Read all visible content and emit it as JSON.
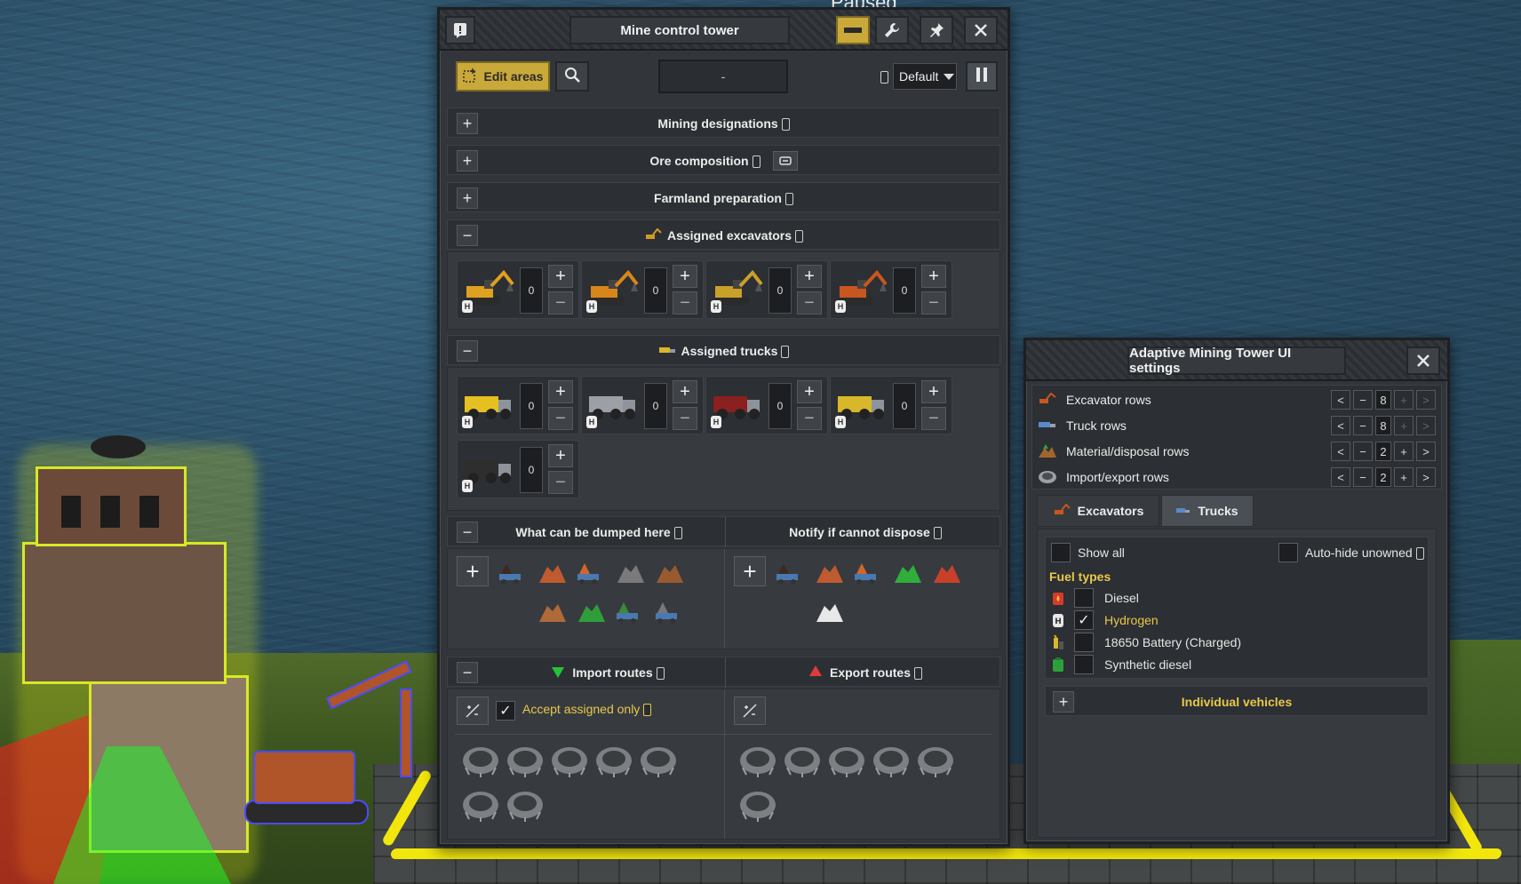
{
  "overlay": {
    "paused_label": "Paused"
  },
  "tower": {
    "title": "Mine control tower",
    "edit_areas_label": "Edit areas",
    "name_value": "-",
    "priority_select": "Default",
    "sections": {
      "mining_designations": "Mining designations",
      "ore_composition": "Ore composition",
      "farmland_preparation": "Farmland preparation",
      "assigned_excavators": "Assigned excavators",
      "assigned_trucks": "Assigned trucks",
      "what_can_be_dumped": "What can be dumped here",
      "notify_cannot_dispose": "Notify if cannot dispose",
      "import_routes": "Import routes",
      "export_routes": "Export routes"
    },
    "excavators": [
      {
        "count": "0",
        "color": "#e0a020"
      },
      {
        "count": "0",
        "color": "#d8861a"
      },
      {
        "count": "0",
        "color": "#c9a028"
      },
      {
        "count": "0",
        "color": "#c8561e"
      }
    ],
    "trucks": [
      {
        "count": "0",
        "color": "#e6c020"
      },
      {
        "count": "0",
        "color": "#9aa0a6"
      },
      {
        "count": "0",
        "color": "#8a2020"
      },
      {
        "count": "0",
        "color": "#d8b82a"
      },
      {
        "count": "0",
        "color": "#2e2e2e"
      }
    ],
    "vehicle_tag": "H",
    "accept_assigned_only_label": "Accept assigned only",
    "accept_assigned_only_checked": true,
    "dumped_materials": [
      "dirt-icon",
      "rock-icon",
      "copper-ore-icon",
      "coal-icon",
      "iron-ore-icon",
      "wood-icon",
      "malachite-icon",
      "green-rock-icon",
      "gravel-icon"
    ],
    "notify_materials": [
      "dirt-icon",
      "rock-icon",
      "copper-ore-icon",
      "green-crystal-icon",
      "red-ore-icon",
      "quartz-icon"
    ],
    "import_pits": 7,
    "export_pits": 6
  },
  "settings": {
    "title": "Adaptive Mining Tower UI settings",
    "rows": [
      {
        "label": "Excavator rows",
        "value": "8"
      },
      {
        "label": "Truck rows",
        "value": "8"
      },
      {
        "label": "Material/disposal rows",
        "value": "2"
      },
      {
        "label": "Import/export rows",
        "value": "2"
      }
    ],
    "tabs": {
      "excavators": "Excavators",
      "trucks": "Trucks"
    },
    "show_all_label": "Show all",
    "auto_hide_label": "Auto-hide unowned",
    "fuel_types_label": "Fuel types",
    "fuel_types": [
      {
        "label": "Diesel",
        "checked": false
      },
      {
        "label": "Hydrogen",
        "checked": true
      },
      {
        "label": "18650 Battery (Charged)",
        "checked": false
      },
      {
        "label": "Synthetic diesel",
        "checked": false
      }
    ],
    "individual_vehicles_label": "Individual vehicles",
    "accent_color": "#e8c84a"
  }
}
